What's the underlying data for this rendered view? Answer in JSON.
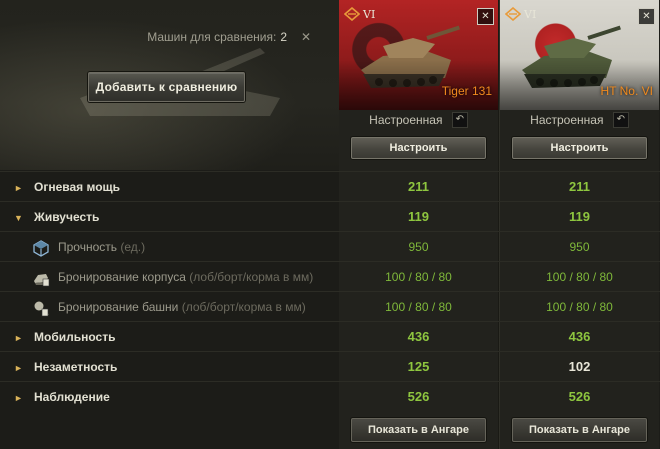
{
  "header": {
    "compare_label": "Машин для сравнения:",
    "compare_count": "2",
    "clear_icon": "close-icon",
    "add_button": "Добавить к сравнению"
  },
  "vehicles": [
    {
      "tier": "VI",
      "name": "Tiger 131",
      "name_color": "#f08a1e",
      "config_label": "Настроенная",
      "setup_button": "Настроить",
      "hangar_button": "Показать в Ангаре"
    },
    {
      "tier": "VI",
      "name": "HT No. VI",
      "name_color": "#f08a1e",
      "config_label": "Настроенная",
      "setup_button": "Настроить",
      "hangar_button": "Показать в Ангаре"
    }
  ],
  "rows": [
    {
      "type": "main",
      "expanded": false,
      "label": "Огневая мощь",
      "values": [
        "211",
        "211"
      ]
    },
    {
      "type": "main",
      "expanded": true,
      "label": "Живучесть",
      "values": [
        "119",
        "119"
      ]
    },
    {
      "type": "sub",
      "icon": "hitpoints-icon",
      "label": "Прочность",
      "unit": "(ед.)",
      "values": [
        "950",
        "950"
      ]
    },
    {
      "type": "sub",
      "icon": "hull-armor-icon",
      "label": "Бронирование корпуса",
      "unit": "(лоб/борт/корма в мм)",
      "values": [
        "100 / 80 / 80",
        "100 / 80 / 80"
      ]
    },
    {
      "type": "sub",
      "icon": "turret-armor-icon",
      "label": "Бронирование башни",
      "unit": "(лоб/борт/корма в мм)",
      "values": [
        "100 / 80 / 80",
        "100 / 80 / 80"
      ]
    },
    {
      "type": "main",
      "expanded": false,
      "label": "Мобильность",
      "values": [
        "436",
        "436"
      ]
    },
    {
      "type": "main",
      "expanded": false,
      "label": "Незаметность",
      "values": [
        "125",
        "102"
      ]
    },
    {
      "type": "main",
      "expanded": false,
      "label": "Наблюдение",
      "values": [
        "526",
        "526"
      ]
    }
  ],
  "colors": {
    "better_value": "#8ec63f",
    "normal_value": "#e8e6d8",
    "accent_arrow": "#d9b25a",
    "tank_name": "#f08a1e"
  }
}
